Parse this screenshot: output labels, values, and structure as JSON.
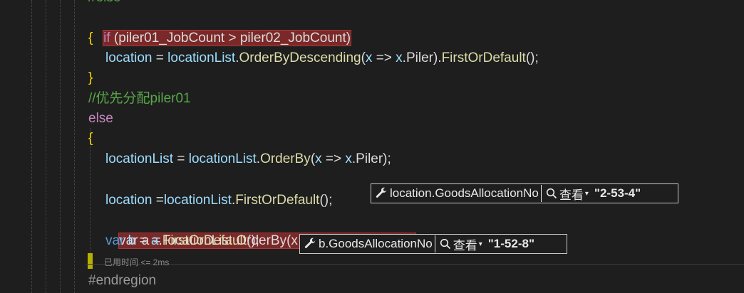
{
  "code": {
    "l0_comment": "//else",
    "l1_if": "if",
    "l1_cond": " (piler01_JobCount > piler02_JobCount)",
    "l2_brace": "{",
    "l3_loc": "location",
    "l3_eq": " = ",
    "l3_list": "locationList",
    "l3_rest1": ".",
    "l3_method": "OrderByDescending",
    "l3_rest2": "(",
    "l3_x": "x",
    "l3_arrow": " => ",
    "l3_x2": "x",
    "l3_rest3": ".Piler).",
    "l3_method2": "FirstOrDefault",
    "l3_end": "();",
    "l4_brace": "}",
    "l5_comment": "//优先分配piler01",
    "l6_else": "else",
    "l7_brace": "{",
    "l8_a": "locationList",
    "l8_eq": " = ",
    "l8_b": "locationList",
    "l8_dot": ".",
    "l8_m": "OrderBy",
    "l8_p": "(",
    "l8_x": "x",
    "l8_arrow": " => ",
    "l8_x2": "x",
    "l8_end": ".Piler);",
    "l9_loc": "location",
    "l9_eq": " =",
    "l9_list": "locationList",
    "l9_dot": ".",
    "l9_m": "FirstOrDefault",
    "l9_end": "();",
    "l10_text": "var a = locationList.OrderBy(x => x.Piler).ToList();",
    "l11_var": "var",
    "l11_b": " b",
    "l11_eq": " = ",
    "l11_a": "a",
    "l11_dot": ".",
    "l11_m": "FirstOrDefault",
    "l11_end": "();",
    "l12_perf": "已用时间 <= 2ms",
    "l13_region": "#endregion"
  },
  "datatips": {
    "tip1": {
      "expr": "location.GoodsAllocationNo",
      "view": "查看",
      "caret": "▾",
      "value": "\"2-53-4\""
    },
    "tip2": {
      "expr": "b.GoodsAllocationNo",
      "view": "查看",
      "caret": "▾",
      "value": "\"1-52-8\""
    }
  },
  "colors": {
    "background": "#1e1e1e",
    "highlight": "#7a2828",
    "keyword": "#569cd6",
    "comment": "#57a64a",
    "identifier": "#9cdcfe",
    "method": "#dcdcaa"
  },
  "icons": [
    "wrench-icon",
    "magnifier-icon",
    "chevron-down-icon"
  ]
}
